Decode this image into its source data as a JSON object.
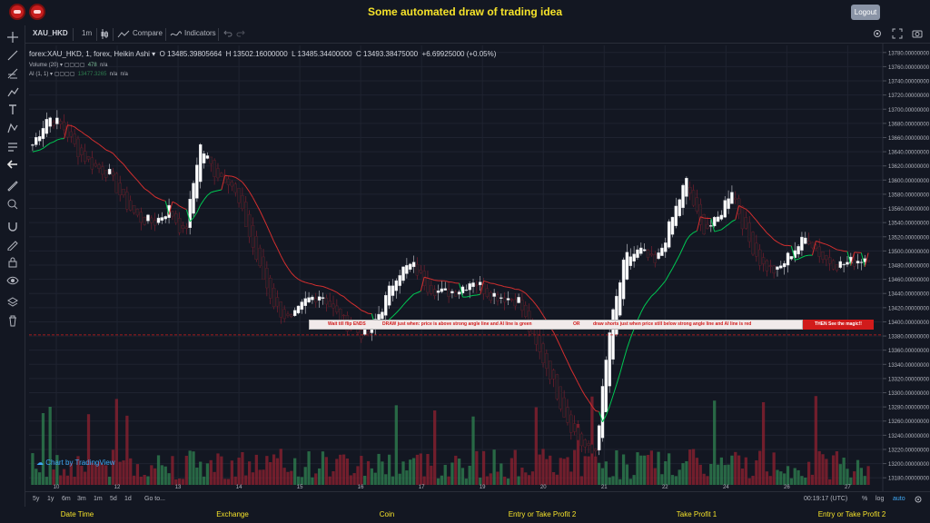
{
  "app": {
    "title": "Some automated draw of trading idea",
    "logout_label": "Logout"
  },
  "toolbar": {
    "symbol": "XAU_HKD",
    "interval": "1m",
    "compare_label": "Compare",
    "indicators_label": "Indicators"
  },
  "legend": {
    "series": "forex:XAU_HKD, 1, forex, Heikin Ashi",
    "open": "O 13485.39805664",
    "high": "H 13502.16000000",
    "low": "L 13485.34400000",
    "close": "C 13493.38475000",
    "change": "+6.69925000 (+0.05%)",
    "volume_label": "Volume (20)",
    "volume_value": "478",
    "volume_na": "n/a",
    "ai_label": "AI (1, 1)",
    "ai_value": "13477.3265",
    "ai_na1": "n/a",
    "ai_na2": "n/a"
  },
  "strip": {
    "part1": "Wait till flip ENDS",
    "part2": "DRAW just when:  price is above strong angle line and AI line is green",
    "part3": "OR",
    "part4": "draw shorts just when price still below strong angle line and AI line is red",
    "magic": "THEN See the magic!!"
  },
  "attribution": "Chart by TradingView",
  "bottombar": {
    "ranges": [
      "5y",
      "1y",
      "6m",
      "3m",
      "1m",
      "5d",
      "1d"
    ],
    "goto": "Go to...",
    "clock": "00:19:17 (UTC)",
    "pct": "%",
    "log": "log",
    "auto": "auto"
  },
  "footer": [
    "Date Time",
    "Exchange",
    "Coin",
    "Entry or Take Profit 2",
    "Take Profit 1",
    "Entry or Take Profit 2"
  ],
  "colors": {
    "up": "#2e7d4f",
    "down": "#8a2130",
    "ha_up": "#ffffff",
    "ai_green": "#00c853",
    "ai_red": "#d32f2f",
    "accent": "#f6e32a",
    "price_label": "#000000",
    "line_label": "#d11b1b"
  },
  "chart_data": {
    "type": "candlestick",
    "title": "forex:XAU_HKD, 1, forex, Heikin Ashi",
    "x": [
      "10",
      "12",
      "13",
      "14",
      "15",
      "16",
      "17",
      "19",
      "20",
      "21",
      "22",
      "24",
      "26",
      "27"
    ],
    "y_ticks": [
      "13780.00000000",
      "13760.00000000",
      "13740.00000000",
      "13720.00000000",
      "13700.00000000",
      "13680.00000000",
      "13660.00000000",
      "13640.00000000",
      "13620.00000000",
      "13600.00000000",
      "13580.00000000",
      "13560.00000000",
      "13540.00000000",
      "13520.00000000",
      "13500.00000000",
      "13480.00000000",
      "13460.00000000",
      "13440.00000000",
      "13420.00000000",
      "13400.00000000",
      "13380.00000000",
      "13360.00000000",
      "13340.00000000",
      "13320.00000000",
      "13300.00000000",
      "13280.00000000",
      "13260.00000000",
      "13240.00000000",
      "13220.00000000",
      "13200.00000000",
      "13180.00000000"
    ],
    "ylim": [
      13170,
      13790
    ],
    "last_price_label": "13496.36417875",
    "last_price": 13496.36,
    "line_price_label": "13381.55437258",
    "line_price": 13381.55,
    "close_path": [
      13650,
      13690,
      13675,
      13640,
      13620,
      13610,
      13570,
      13545,
      13540,
      13560,
      13520,
      13650,
      13610,
      13600,
      13540,
      13470,
      13420,
      13400,
      13430,
      13440,
      13410,
      13390,
      13380,
      13420,
      13470,
      13480,
      13450,
      13440,
      13445,
      13460,
      13440,
      13435,
      13430,
      13370,
      13330,
      13270,
      13230,
      13210,
      13390,
      13490,
      13500,
      13480,
      13540,
      13600,
      13530,
      13540,
      13590,
      13520,
      13480,
      13470,
      13500,
      13520,
      13490,
      13480,
      13485,
      13493
    ],
    "grid": true
  }
}
